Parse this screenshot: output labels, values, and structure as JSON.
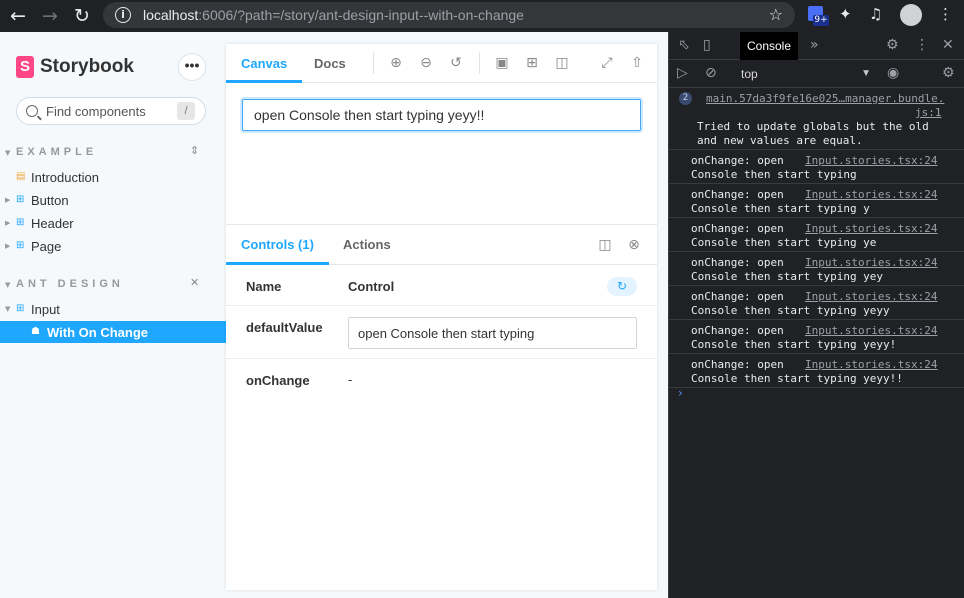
{
  "browser": {
    "url_host": "localhost",
    "url_path": ":6006/?path=/story/ant-design-input--with-on-change",
    "ext_badge": "9+"
  },
  "sidebar": {
    "brand": "Storybook",
    "search_placeholder": "Find components",
    "search_shortcut": "/",
    "groups": [
      {
        "title": "EXAMPLE",
        "items": [
          {
            "label": "Introduction",
            "icon": "document-icon"
          },
          {
            "label": "Button",
            "icon": "component-icon"
          },
          {
            "label": "Header",
            "icon": "component-icon"
          },
          {
            "label": "Page",
            "icon": "component-icon"
          }
        ]
      },
      {
        "title": "ANT DESIGN",
        "items": [
          {
            "label": "Input",
            "icon": "component-icon"
          },
          {
            "label": "With On Change",
            "icon": "bookmark-icon",
            "selected": true
          }
        ]
      }
    ]
  },
  "preview": {
    "tabs": [
      "Canvas",
      "Docs"
    ],
    "active_tab": "Canvas",
    "input_value": "open Console then start typing yeyy!!"
  },
  "addons": {
    "tabs": [
      "Controls (1)",
      "Actions"
    ],
    "active_tab": "Controls (1)",
    "header_name": "Name",
    "header_control": "Control",
    "rows": [
      {
        "name": "defaultValue",
        "control": "open Console then start typing"
      },
      {
        "name": "onChange",
        "control": "-"
      }
    ]
  },
  "devtools": {
    "active_tab": "Console",
    "context": "top",
    "messages": [
      {
        "badge": "2",
        "source": "main.57da3f9fe16e025…manager.bundle.",
        "source2": "js:1",
        "text1": "Tried to update globals but the old",
        "text2": "and new values are equal."
      },
      {
        "text1": "onChange: open",
        "text2": "Console then start typing",
        "source": "Input.stories.tsx:24"
      },
      {
        "text1": "onChange: open",
        "text2": "Console then start typing y",
        "source": "Input.stories.tsx:24"
      },
      {
        "text1": "onChange: open",
        "text2": "Console then start typing ye",
        "source": "Input.stories.tsx:24"
      },
      {
        "text1": "onChange: open",
        "text2": "Console then start typing yey",
        "source": "Input.stories.tsx:24"
      },
      {
        "text1": "onChange: open",
        "text2": "Console then start typing yeyy",
        "source": "Input.stories.tsx:24"
      },
      {
        "text1": "onChange: open",
        "text2": "Console then start typing yeyy!",
        "source": "Input.stories.tsx:24"
      },
      {
        "text1": "onChange: open",
        "text2": "Console then start typing yeyy!!",
        "source": "Input.stories.tsx:24"
      }
    ]
  }
}
